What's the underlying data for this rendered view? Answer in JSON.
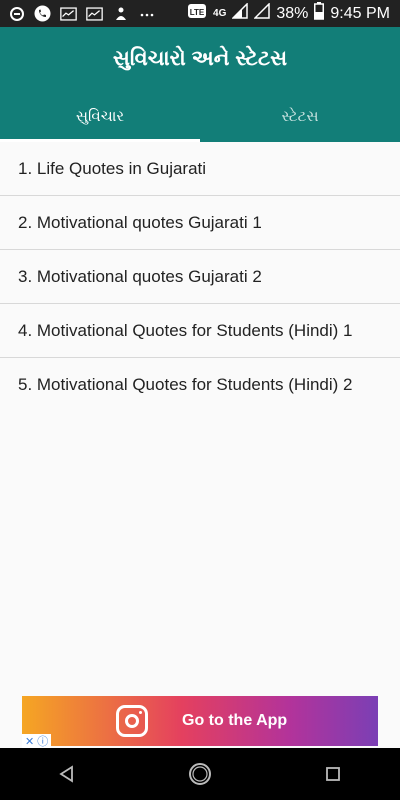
{
  "status_bar": {
    "battery": "38%",
    "time": "9:45 PM",
    "network": "4G",
    "volte": "VO LTE"
  },
  "app_bar": {
    "title": "સુવિચારો અને સ્ટેટસ"
  },
  "tabs": [
    {
      "label": "સુવિચાર",
      "active": true
    },
    {
      "label": "સ્ટેટસ",
      "active": false
    }
  ],
  "list": {
    "items": [
      {
        "label": "1. Life Quotes in Gujarati"
      },
      {
        "label": "2. Motivational quotes Gujarati 1"
      },
      {
        "label": "3. Motivational quotes Gujarati 2"
      },
      {
        "label": "4. Motivational Quotes for Students (Hindi) 1"
      },
      {
        "label": "5. Motivational Quotes for Students (Hindi) 2"
      }
    ]
  },
  "ad": {
    "cta": "Go to the App",
    "close_label": "✕ ⓘ"
  },
  "colors": {
    "primary": "#127e78",
    "status_bar": "#222222",
    "nav_bar": "#000000"
  }
}
